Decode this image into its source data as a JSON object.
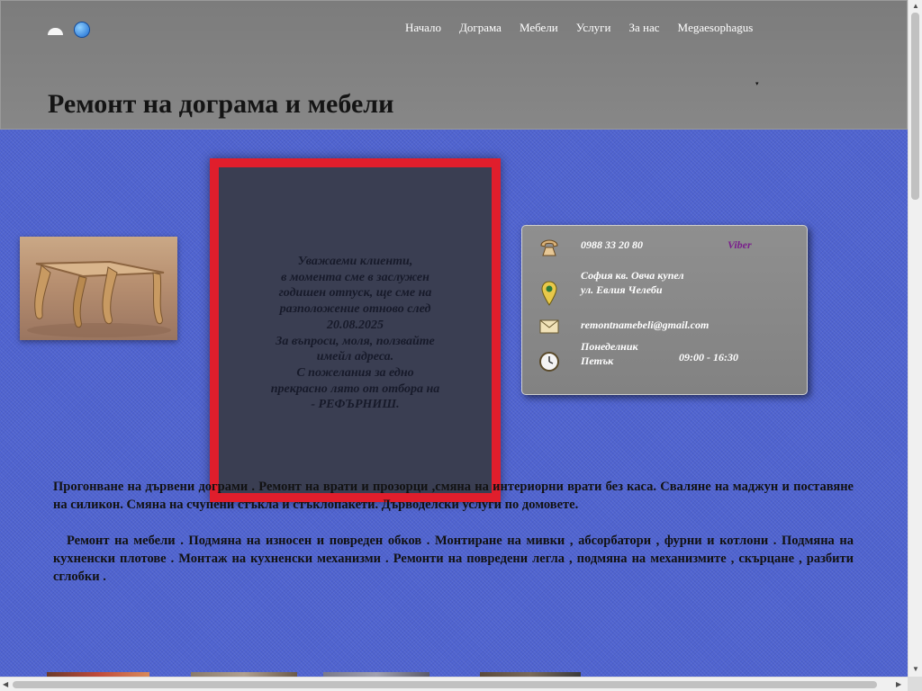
{
  "nav": {
    "items": [
      {
        "label": "Начало"
      },
      {
        "label": "Дограма"
      },
      {
        "label": "Мебели"
      },
      {
        "label": "Услуги"
      },
      {
        "label": "За нас"
      },
      {
        "label": "Megaesophagus"
      }
    ],
    "caret": "▾"
  },
  "page": {
    "title": "Ремонт на дограма и мебели"
  },
  "notice": {
    "lines": [
      "Уважаеми клиенти,",
      "в момента сме в заслужен",
      "годишен отпуск, ще сме на",
      "разположение отново след",
      "20.08.2025",
      "За въпроси, моля, ползвайте",
      "имейл адреса.",
      "С пожелания за  едно",
      "прекрасно лято от отбора на",
      "- РЕФЪРНИШ."
    ]
  },
  "contact": {
    "phone": "0988 33 20 80",
    "viber": "Viber",
    "address_line1": "София  кв. Овча купел",
    "address_line2": "ул. Евлия Челеби",
    "email": "remontnamebeli@gmail.com",
    "days_line1": "Понеделник",
    "days_line2": "Петък",
    "hours": "09:00 - 16:30",
    "icons": [
      "phone-icon",
      "map-pin-icon",
      "envelope-icon",
      "clock-icon"
    ],
    "viber_color": "#7a1f8c"
  },
  "content": {
    "paragraph1": "Прогонване  на  дървени  дограми . Ремонт на врати и прозорци ,смяна  на интериорни  врати  без  каса.  Сваляне на маджун и поставяне на силикон.  Смяна на счупени стъкла и стъклопакети. Дърводелски услуги по домовете.",
    "paragraph2": "Ремонт  на  мебели . Подмяна  на  износен  и  повреден  обков  . Монтиране  на  мивки , абсорбатори , фурни  и  котлони . Подмяна  на  кухненски  плотове . Монтаж  на  кухненски  механизми .  Ремонти  на  повредени  легла , подмяна  на механизмите , скърцане , разбити  сглобки ."
  },
  "colors": {
    "background": "#4f63d0",
    "header": "#828282",
    "notice_border": "#e01e2c",
    "notice_bg": "#3a3e52"
  }
}
